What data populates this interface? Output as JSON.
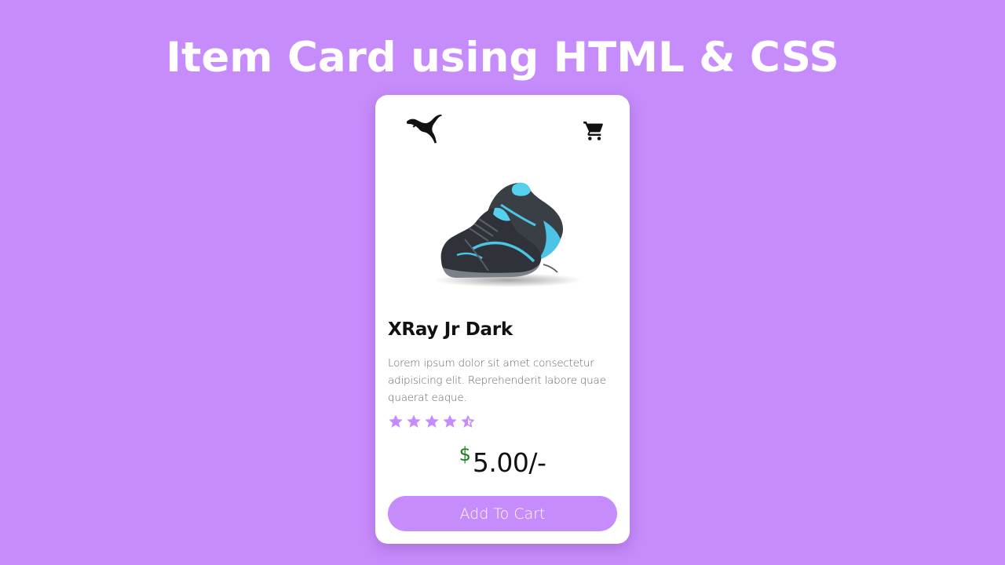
{
  "header": {
    "title": "Item Card using HTML & CSS"
  },
  "card": {
    "brand_logo": "puma-logo",
    "cart_icon": "cart-icon",
    "product_image": "running-shoes-image",
    "product": {
      "name": "XRay Jr Dark",
      "description": "Lorem ipsum dolor sit amet consectetur adipisicing elit. Reprehenderit labore quae quaerat eaque.",
      "rating": 4.5,
      "rating_max": 5,
      "currency_symbol": "$",
      "price": "5.00/-"
    },
    "add_to_cart_label": "Add To Cart"
  },
  "colors": {
    "background": "#c78cfc",
    "accent": "#c78cfc",
    "card": "#ffffff",
    "currency": "#1a7f1a",
    "star": "#c78cfc"
  }
}
